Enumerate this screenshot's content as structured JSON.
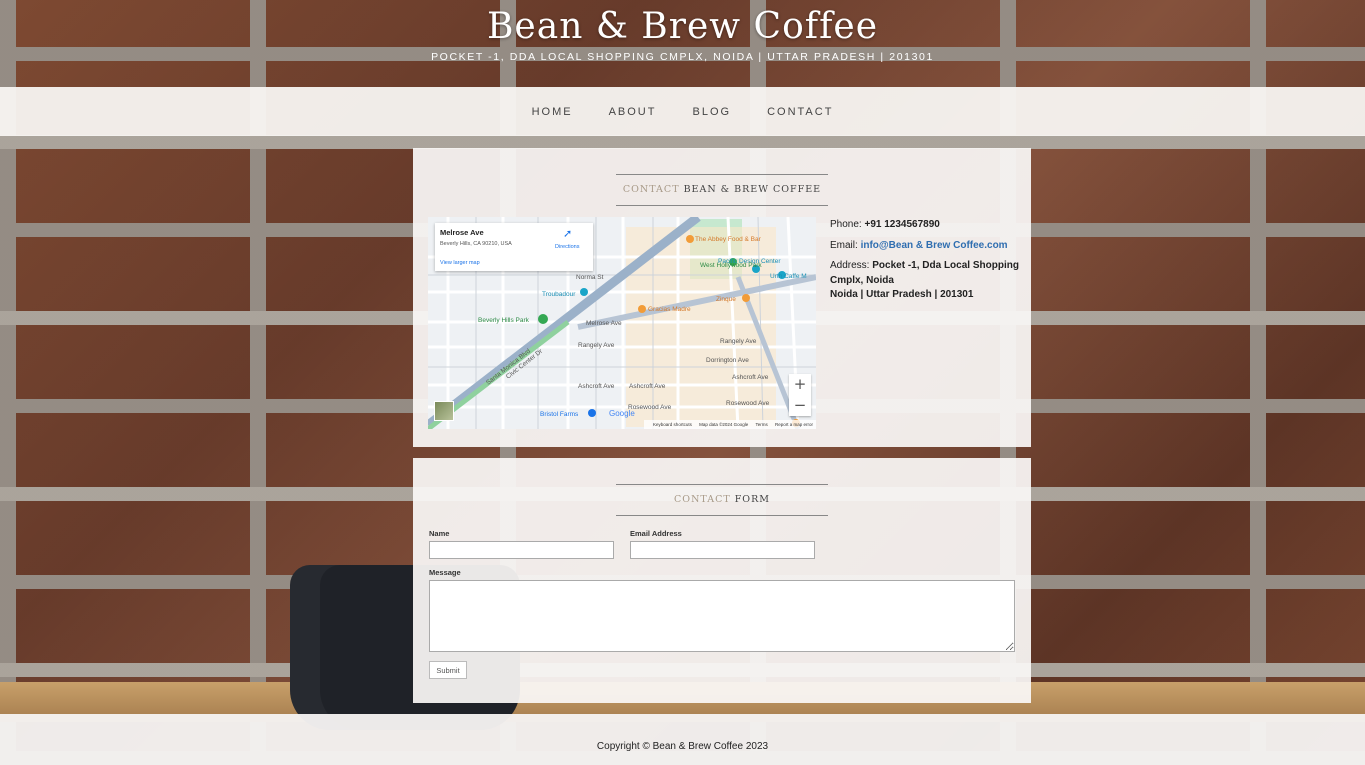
{
  "site": {
    "title": "Bean & Brew Coffee",
    "tagline": "POCKET -1, DDA LOCAL SHOPPING CMPLX, NOIDA | UTTAR PRADESH | 201301"
  },
  "nav": {
    "items": [
      {
        "label": "HOME"
      },
      {
        "label": "ABOUT"
      },
      {
        "label": "BLOG"
      },
      {
        "label": "CONTACT"
      }
    ]
  },
  "contact_box": {
    "heading_muted": "CONTACT",
    "heading_strong": "BEAN & BREW COFFEE",
    "map": {
      "place_name": "Melrose Ave",
      "place_address": "Beverly Hills, CA 90210, USA",
      "view_larger": "View larger map",
      "directions": "Directions",
      "zoom_in": "+",
      "zoom_out": "−",
      "google": "Google",
      "footer_shortcuts": "Keyboard shortcuts",
      "footer_data": "Map data ©2024 Google",
      "footer_terms": "Terms",
      "footer_report": "Report a map error",
      "labels": {
        "abbey": "The Abbey Food & Bar",
        "pacific": "Pacific Design Center",
        "hollywood_park": "West Hollywood Park",
        "urth": "Urth Caffe M",
        "troubadour": "Troubadour",
        "beverly_park": "Beverly Hills Park",
        "gracias": "Gracias Madre",
        "zinque": "Zinque",
        "bristol": "Bristol Farms",
        "melrose": "Melrose Ave",
        "rangely_1": "Rangely Ave",
        "rangely_2": "Rangely Ave",
        "ashcroft_1": "Ashcroft Ave",
        "ashcroft_2": "Ashcroft Ave",
        "ashcroft_3": "Ashcroft Ave",
        "rosewood_1": "Rosewood Ave",
        "rosewood_2": "Rosewood Ave",
        "dorrington": "Dorrington Ave",
        "santa_monica": "Santa Monica Blvd",
        "civic": "Civic Center Dr",
        "norma": "Norma St"
      }
    },
    "phone_label": "Phone:",
    "phone": "+91 1234567890",
    "email_label": "Email:",
    "email": "info@Bean & Brew Coffee.com",
    "address_label": "Address:",
    "address_line1": "Pocket -1, Dda Local Shopping Cmplx, Noida",
    "address_line2": "Noida | Uttar Pradesh | 201301"
  },
  "form_box": {
    "heading_muted": "CONTACT",
    "heading_strong": "FORM",
    "name_label": "Name",
    "name_value": "",
    "email_label": "Email Address",
    "email_value": "",
    "message_label": "Message",
    "message_value": "",
    "submit_label": "Submit"
  },
  "footer": {
    "copyright": "Copyright © Bean & Brew Coffee 2023"
  },
  "colors": {
    "link": "#2f6eb0",
    "heading_muted": "#a89a88"
  }
}
